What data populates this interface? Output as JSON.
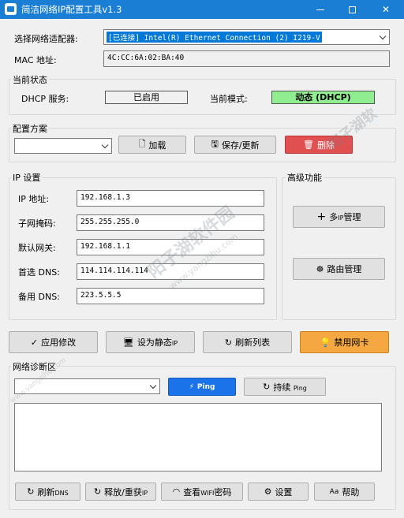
{
  "window": {
    "title": "简洁网络IP配置工具v1.3"
  },
  "adapter": {
    "label": "选择网络适配器:",
    "selected": "[已连接] Intel(R) Ethernet Connection (2) I219-V",
    "mac_label": "MAC 地址:",
    "mac_value": "4C:CC:6A:02:BA:40"
  },
  "status": {
    "group_title": "当前状态",
    "dhcp_label": "DHCP 服务:",
    "dhcp_value": "已启用",
    "mode_label": "当前模式:",
    "mode_value": "动态 (DHCP)",
    "mode_color": "#90ee90"
  },
  "profiles": {
    "group_title": "配置方案",
    "selected": "",
    "load_label": "加载",
    "save_label": "保存/更新",
    "delete_label": "删除",
    "delete_color": "#e05050"
  },
  "ip": {
    "group_title": "IP 设置",
    "ip_label": "IP 地址:",
    "ip_value": "192.168.1.3",
    "mask_label": "子网掩码:",
    "mask_value": "255.255.255.0",
    "gw_label": "默认网关:",
    "gw_value": "192.168.1.1",
    "dns1_label": "首选 DNS:",
    "dns1_value": "114.114.114.114",
    "dns2_label": "备用 DNS:",
    "dns2_value": "223.5.5.5"
  },
  "advanced": {
    "group_title": "高级功能",
    "multi_ip_label": "多",
    "multi_ip_small": "IP",
    "multi_ip_suffix": "管理",
    "route_label": "路由管理"
  },
  "actions": {
    "apply_label": "应用修改",
    "static_label": "设为静态",
    "static_small": "IP",
    "refresh_label": "刷新列表",
    "disable_label": "禁用网卡",
    "disable_color": "#f5a742"
  },
  "diag": {
    "group_title": "网络诊断区",
    "target": "",
    "ping_label": "Ping",
    "ping_color": "#1a73e8",
    "ping_cont_label": "持续",
    "ping_cont_small": "Ping",
    "output": ""
  },
  "bottom": {
    "flush_label": "刷新",
    "flush_small": "DNS",
    "release_label": "释放/重获",
    "release_small": "IP",
    "wifi_label": "查看",
    "wifi_small": "WIFI",
    "wifi_suffix": "密码",
    "settings_label": "设置",
    "help_label": "帮助"
  },
  "watermark": {
    "text1": "阳子湖软件园",
    "url1": "www.yangzihu.com",
    "text2": "阳子湖软",
    "url2": "www.yangzihu.com"
  }
}
